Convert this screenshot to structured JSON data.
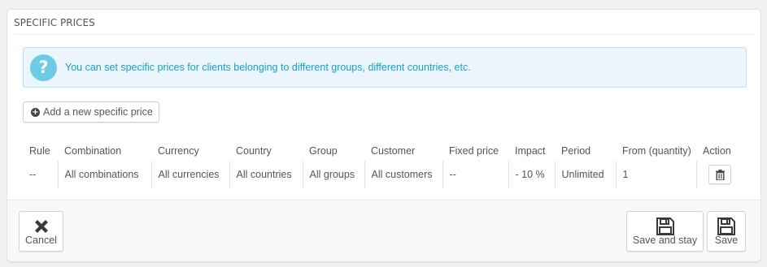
{
  "panel": {
    "title": "SPECIFIC PRICES",
    "alert_text": "You can set specific prices for clients belonging to different groups, different countries, etc.",
    "alert_icon": "question-circle-icon",
    "add_button_label": "Add a new specific price"
  },
  "table": {
    "headers": [
      "Rule",
      "Combination",
      "Currency",
      "Country",
      "Group",
      "Customer",
      "Fixed price",
      "Impact",
      "Period",
      "From (quantity)",
      "Action"
    ],
    "rows": [
      {
        "rule": "--",
        "combination": "All combinations",
        "currency": "All currencies",
        "country": "All countries",
        "group": "All groups",
        "customer": "All customers",
        "fixed_price": "--",
        "impact": "- 10 %",
        "period": "Unlimited",
        "from_quantity": "1",
        "action_icon": "trash-icon"
      }
    ]
  },
  "footer": {
    "cancel_label": "Cancel",
    "save_and_stay_label": "Save and stay",
    "save_label": "Save"
  },
  "colors": {
    "alert_text": "#1ba0c5",
    "alert_bg": "#eaf6fb",
    "alert_icon": "#6ecbe6"
  }
}
